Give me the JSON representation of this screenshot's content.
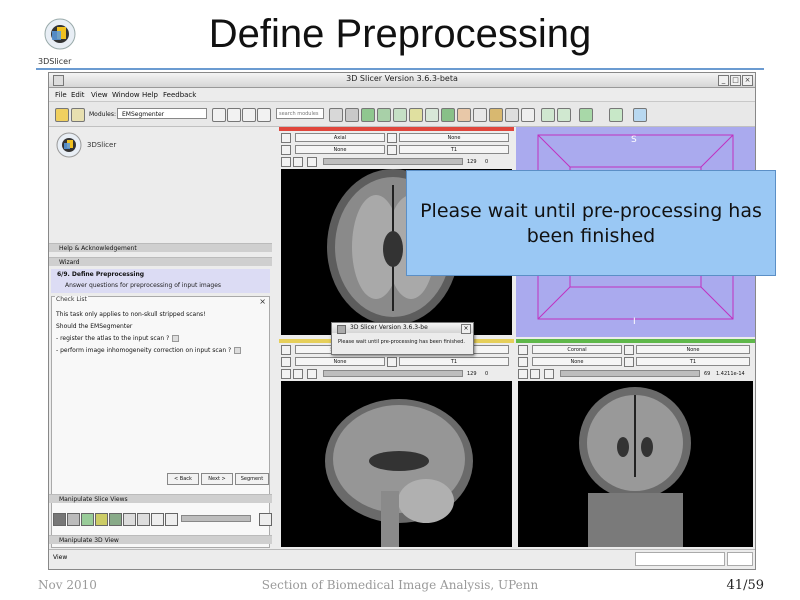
{
  "slide": {
    "title": "Define Preprocessing",
    "logo_text": "3DSlicer",
    "footer_left": "Nov 2010",
    "footer_center": "Section of Biomedical Image Analysis, UPenn",
    "footer_page": "41/59"
  },
  "window": {
    "title": "3D Slicer Version 3.6.3-beta",
    "menu": [
      "File",
      "Edit",
      "View",
      "Window",
      "Help",
      "Feedback"
    ],
    "modules_label": "Modules:",
    "module_selected": "EMSegmenter",
    "search_placeholder": "search modules"
  },
  "left_panel": {
    "logo_text": "3DSlicer",
    "help_section": "Help & Acknowledgement",
    "wizard_section": "Wizard",
    "step_title": "6/9. Define Preprocessing",
    "step_desc": "Answer questions for preprocessing of input images",
    "checklist_title": "Check List",
    "checklist_lines": [
      "This task only applies to non-skull stripped scans!",
      "Should the EMSegmenter",
      "- register the atlas to the input scan ?",
      "- perform image inhomogeneity correction on input scan ?"
    ],
    "back_label": "< Back",
    "next_label": "Next >",
    "segment_label": "Segment",
    "slice_views_section": "Manipulate Slice Views",
    "view3d_section": "Manipulate 3D View"
  },
  "views": {
    "red": {
      "orientation": "Axial",
      "fg": "None",
      "bg": "None",
      "label": "T1",
      "slider_value": "129",
      "offset": "0"
    },
    "yellow": {
      "orientation": "Sagittal",
      "fg": "None",
      "bg": "None",
      "label": "T1",
      "slider_value": "129",
      "offset": "0"
    },
    "green": {
      "orientation": "Coronal",
      "fg": "None",
      "bg": "None",
      "label": "T1",
      "slider_value": "69",
      "offset": "1.4211e-14"
    },
    "three_d": {
      "superior": "S",
      "inferior": "I"
    }
  },
  "overlay": {
    "message": "Please wait until pre-processing has been finished"
  },
  "dialog": {
    "title": "3D Slicer Version 3.6.3-be",
    "message": "Please wait until pre-processing has been finished."
  },
  "statusbar": {
    "left": "View"
  },
  "colors": {
    "red_bar": "#e0463c",
    "yellow_bar": "#e6cf5a",
    "green_bar": "#5fb84a",
    "three_d_bg": "#aaaaee",
    "overlay_bg": "#9ac8f4",
    "title_rule": "#6b9bd1"
  }
}
